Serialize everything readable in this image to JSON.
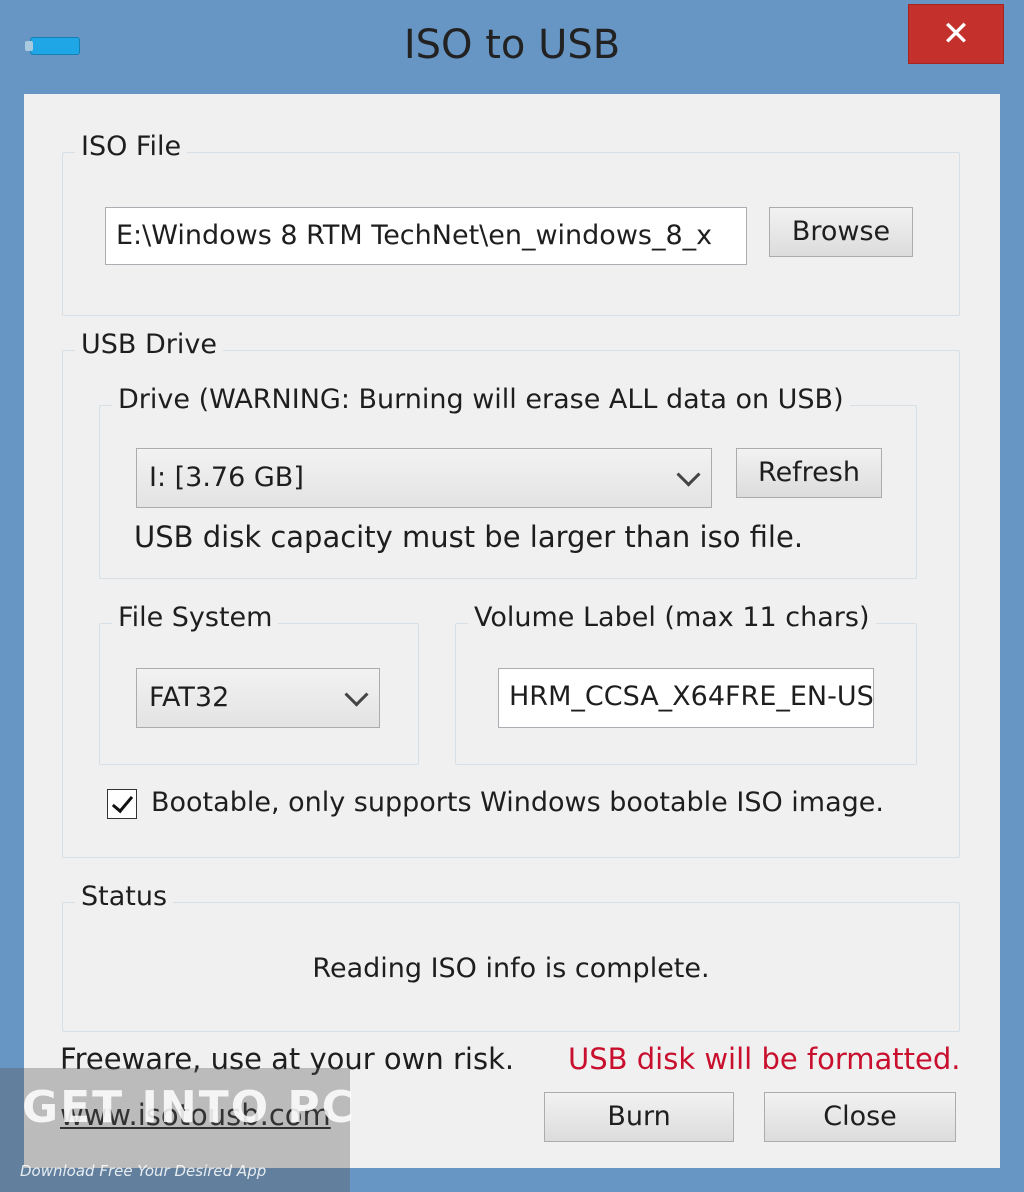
{
  "window": {
    "title": "ISO to USB",
    "close_label": "✕"
  },
  "iso_file": {
    "group_label": "ISO File",
    "path_value": "E:\\Windows 8 RTM TechNet\\en_windows_8_x",
    "browse_label": "Browse"
  },
  "usb_drive": {
    "group_label": "USB Drive",
    "drive_group_label": "Drive (WARNING: Burning will erase ALL data on USB)",
    "drive_selected": "I: [3.76 GB]",
    "refresh_label": "Refresh",
    "capacity_note": "USB disk capacity must be larger than iso file.",
    "file_system_label": "File System",
    "file_system_selected": "FAT32",
    "volume_label_group": "Volume Label (max 11 chars)",
    "volume_label_value": "HRM_CCSA_X64FRE_EN-US",
    "bootable_label": "Bootable, only supports Windows bootable ISO image.",
    "bootable_checked": true
  },
  "status": {
    "group_label": "Status",
    "message": "Reading ISO info is complete."
  },
  "footer": {
    "freeware_note": "Freeware, use at your own risk.",
    "format_warning": "USB disk will be formatted.",
    "website_link": "www.isotousb.com",
    "burn_label": "Burn",
    "close_label": "Close"
  },
  "watermark": {
    "title": "GET INTO PC",
    "subtitle": "Download Free Your Desired App"
  },
  "colors": {
    "frame": "#6896c4",
    "client": "#f0f0f0",
    "close_button": "#c4302b",
    "warning_text": "#c8102e"
  }
}
